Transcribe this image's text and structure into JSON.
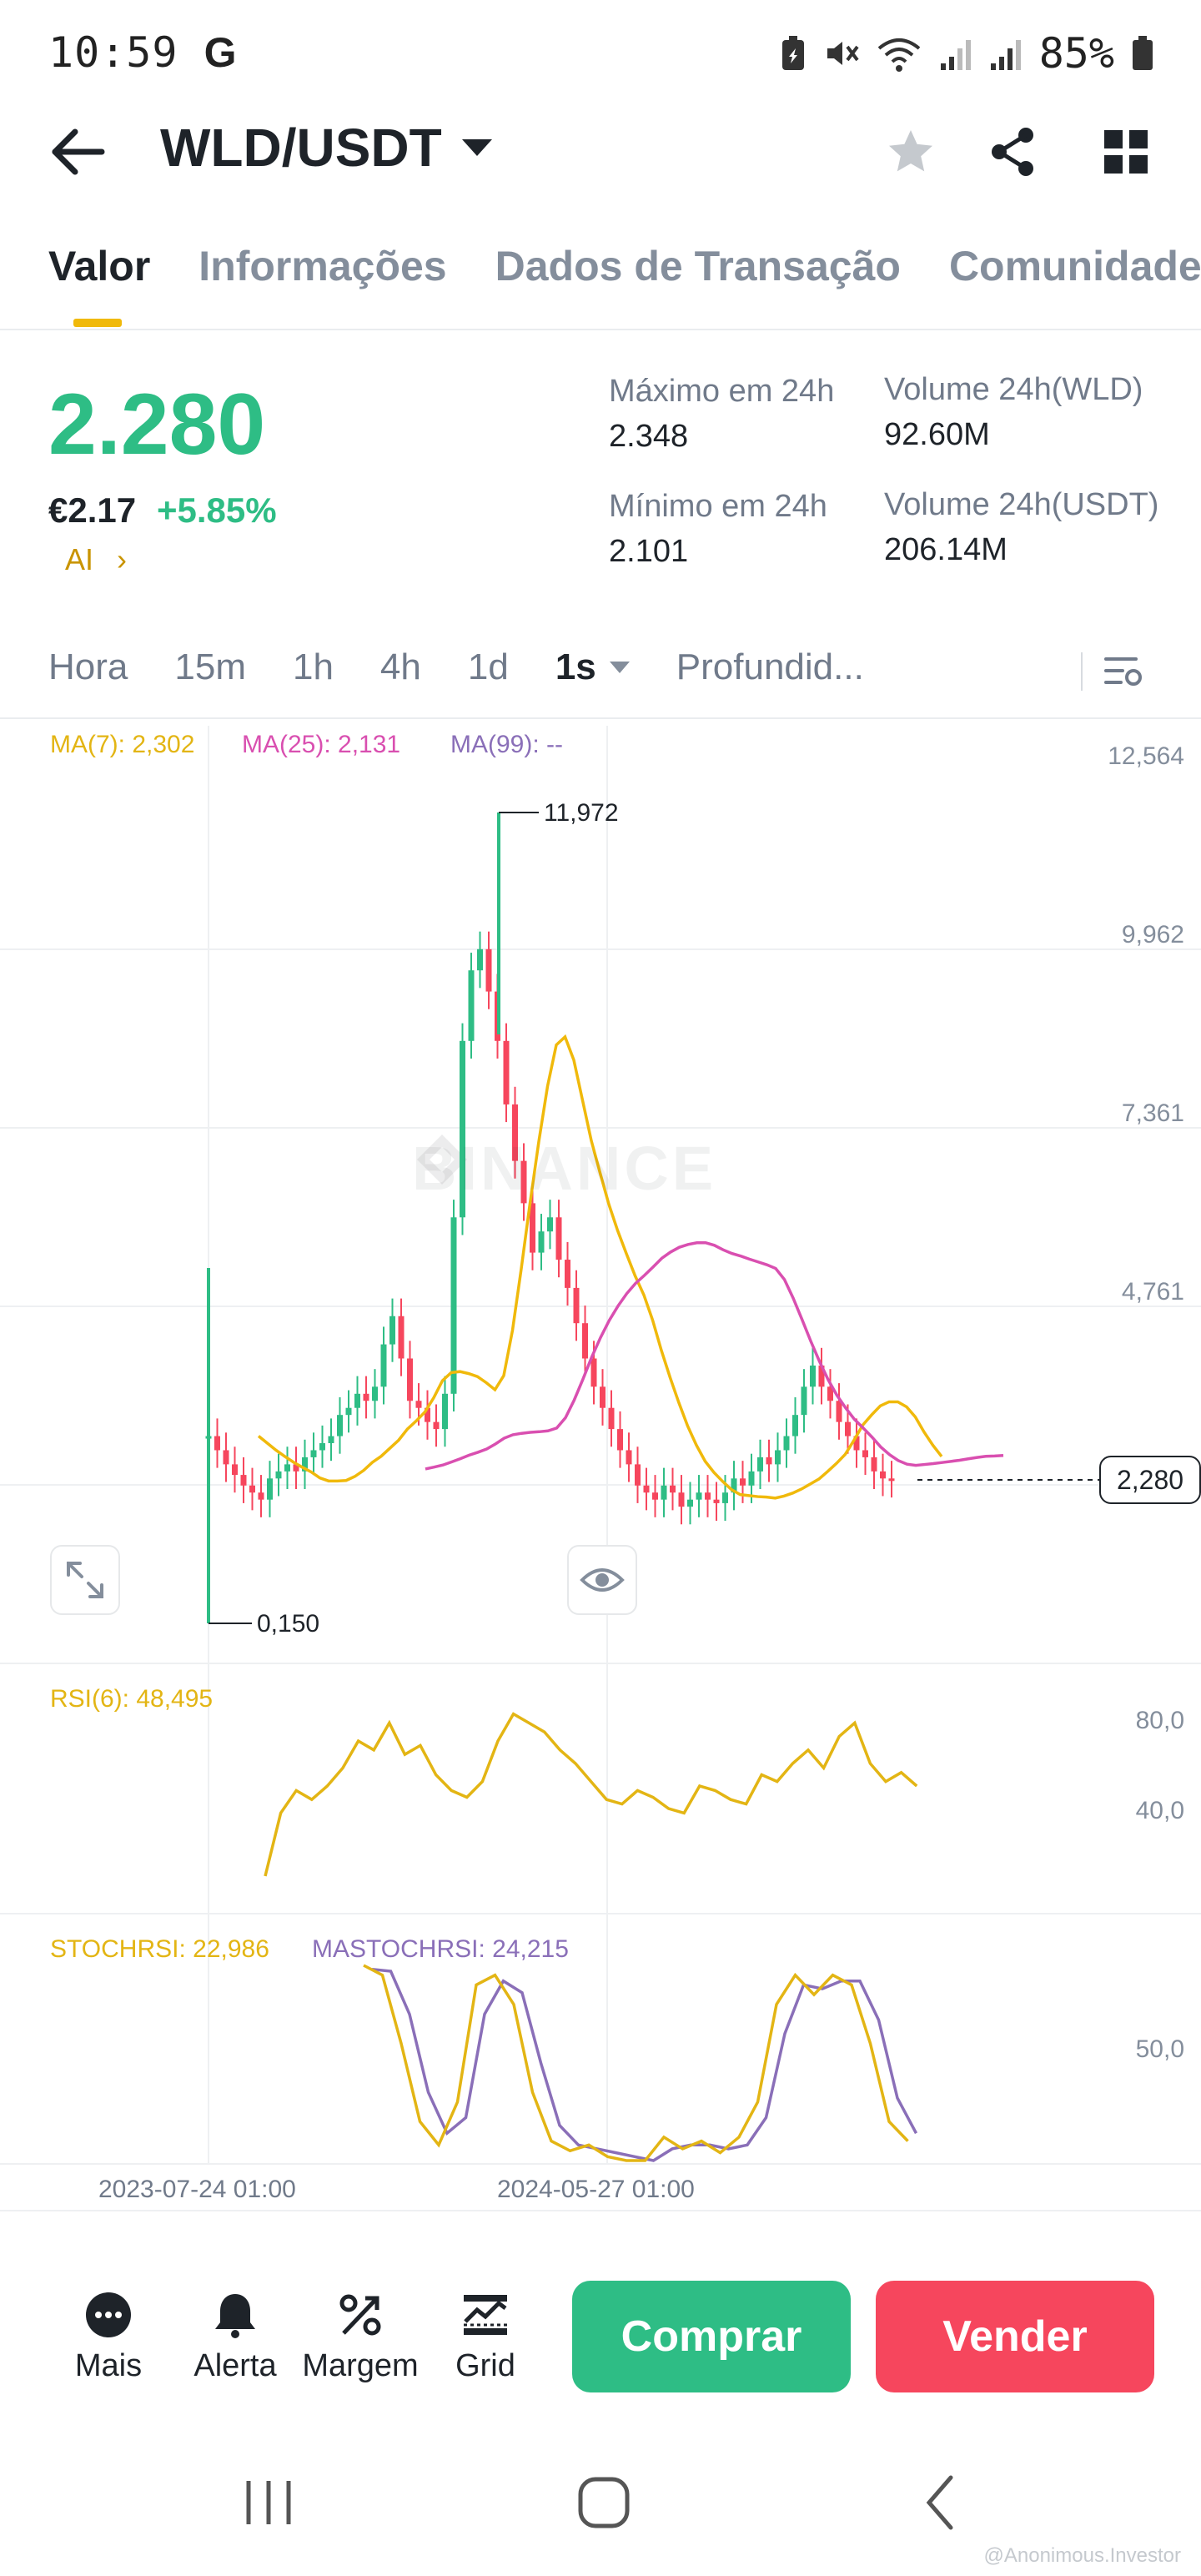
{
  "status_bar": {
    "time": "10:59",
    "carrier_glyph": "G",
    "battery_pct": "85%"
  },
  "header": {
    "pair": "WLD/USDT",
    "icons": [
      "back-arrow-icon",
      "chevron-down-icon",
      "star-icon",
      "share-icon",
      "grid-icon"
    ]
  },
  "tabs": [
    {
      "label": "Valor",
      "active": true
    },
    {
      "label": "Informações",
      "active": false
    },
    {
      "label": "Dados de Transação",
      "active": false
    },
    {
      "label": "Comunidade",
      "active": false
    }
  ],
  "price": {
    "last": "2.280",
    "fiat": "€2.17",
    "change": "+5.85%",
    "ai": "AI",
    "color_up": "#2ebd85"
  },
  "stats": {
    "high_label": "Máximo em 24h",
    "high_value": "2.348",
    "low_label": "Mínimo em 24h",
    "low_value": "2.101",
    "vol_wld_label": "Volume 24h(WLD)",
    "vol_wld_value": "92.60M",
    "vol_usdt_label": "Volume 24h(USDT)",
    "vol_usdt_value": "206.14M"
  },
  "timeframes": {
    "items": [
      "Hora",
      "15m",
      "1h",
      "4h",
      "1d"
    ],
    "selected": "1s",
    "depth": "Profundid..."
  },
  "chart": {
    "ma7": "MA(7): 2,302",
    "ma25": "MA(25): 2,131",
    "ma99": "MA(99): --",
    "high_mark": "11,972",
    "low_mark": "0,150",
    "current_price_tag": "2,280",
    "watermark": "BINANCE",
    "y_ticks": [
      "12,564",
      "9,962",
      "7,361",
      "4,761"
    ],
    "rsi_label": "RSI(6): 48,495",
    "rsi_ticks": [
      "80,0",
      "40,0"
    ],
    "stoch_label": "STOCHRSI: 22,986",
    "mastoch_label": "MASTOCHRSI: 24,215",
    "stoch_tick": "50,0",
    "dates": [
      "2023-07-24 01:00",
      "2024-05-27 01:00"
    ],
    "colors": {
      "up": "#2ebd85",
      "down": "#f6465d",
      "ma7": "#f0b90b",
      "ma25": "#d94fb0",
      "ma99": "#8a6fb8",
      "rsi": "#e3b514",
      "stoch": "#e3b514",
      "mastoch": "#8a6fb8"
    }
  },
  "bottom_bar": {
    "items": [
      {
        "label": "Mais",
        "icon": "more-icon"
      },
      {
        "label": "Alerta",
        "icon": "bell-icon"
      },
      {
        "label": "Margem",
        "icon": "margin-icon"
      },
      {
        "label": "Grid",
        "icon": "grid-bot-icon"
      }
    ],
    "buy": "Comprar",
    "sell": "Vender"
  },
  "credit": "@Anonimous.Investor"
}
